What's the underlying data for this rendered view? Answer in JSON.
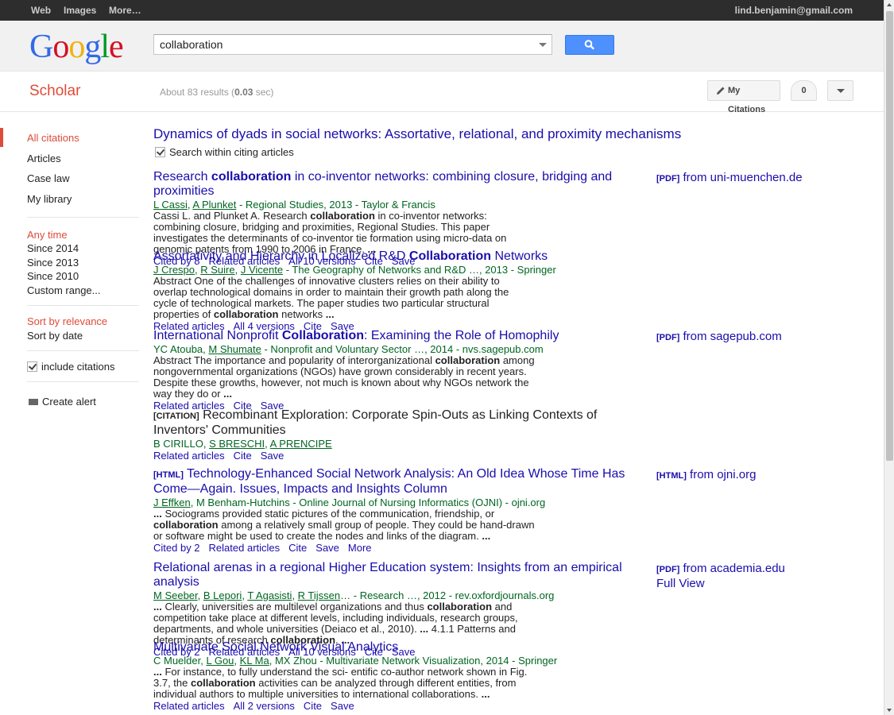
{
  "topbar": {
    "links": [
      "Web",
      "Images",
      "More…"
    ],
    "user": "lind.benjamin@gmail.com"
  },
  "logo": {
    "letters": [
      "G",
      "o",
      "o",
      "g",
      "l",
      "e"
    ],
    "colors": [
      "#3369e8",
      "#d50f25",
      "#eeb211",
      "#3369e8",
      "#009925",
      "#d50f25"
    ]
  },
  "search": {
    "value": "collaboration",
    "button_icon": "search-icon"
  },
  "scholar": {
    "title": "Scholar",
    "stats_prefix": "About 83 results (",
    "stats_time": "0.03",
    "stats_suffix": " sec)",
    "my_citations": "My Citations",
    "notifications": "0"
  },
  "sidebar": {
    "type": [
      "All citations",
      "Articles",
      "Case law",
      "My library"
    ],
    "time": [
      "Any time",
      "Since 2014",
      "Since 2013",
      "Since 2010",
      "Custom range..."
    ],
    "sort": [
      "Sort by relevance",
      "Sort by date"
    ],
    "include_citations": "include citations",
    "create_alert": "Create alert"
  },
  "main": {
    "cited_title": "Dynamics of dyads in social networks: Assortative, relational, and proximity mechanisms",
    "search_within": "Search within citing articles"
  },
  "results": [
    {
      "title_html": "Research <b>collaboration</b> in co-inventor networks: combining closure, bridging and proximities",
      "authors_html": "<span class=\"u\">L Cassi</span>, <span class=\"u\">A Plunket</span> - Regional Studies, 2013 - Taylor &amp; Francis",
      "snippet_html": "Cassi L. and Plunket A. Research <b>collaboration</b> in co-inventor networks: combining closure, bridging and proximities, Regional Studies. This paper investigates the determinants of co-inventor tie formation using micro-data on genomic patents from 1990 to 2006 in France. <b>...</b>",
      "links": [
        "Cited by 8",
        "Related articles",
        "All 10 versions",
        "Cite",
        "Save"
      ],
      "side_tag": "[PDF]",
      "side_text": "from uni-muenchen.de"
    },
    {
      "title_html": "Assortativity and Hierarchy in Localized R&amp;D <b>Collaboration</b> Networks",
      "authors_html": "<span class=\"u\">J Crespo</span>, <span class=\"u\">R Suire</span>, <span class=\"u\">J Vicente</span> - The Geography of Networks and R&amp;D …, 2013 - Springer",
      "snippet_html": "Abstract One of the challenges of innovative clusters relies on their ability to overlap technological domains in order to maintain their growth path along the cycle of technological markets. The paper studies two particular structural properties of <b>collaboration</b> networks <b>...</b>",
      "links": [
        "Related articles",
        "All 4 versions",
        "Cite",
        "Save"
      ]
    },
    {
      "title_html": "International Nonprofit <b>Collaboration</b>: Examining the Role of Homophily",
      "authors_html": "YC Atouba, <span class=\"u\">M Shumate</span> - Nonprofit and Voluntary Sector …, 2014 - nvs.sagepub.com",
      "snippet_html": "Abstract The importance and popularity of interorganizational <b>collaboration</b> among nongovernmental organizations (NGOs) have grown considerably in recent years. Despite these growths, however, not much is known about why NGOs network the way they do or <b>...</b>",
      "links": [
        "Related articles",
        "Cite",
        "Save"
      ],
      "side_tag": "[PDF]",
      "side_text": "from sagepub.com"
    },
    {
      "tag": "[CITATION]",
      "title_html": "Recombinant Exploration: Corporate Spin-Outs as Linking Contexts of Inventors' Communities",
      "authors_html": "B CIRILLO, <span class=\"u\">S BRESCHI</span>, <span class=\"u\">A PRENCIPE</span>",
      "links": [
        "Related articles",
        "Cite",
        "Save"
      ]
    },
    {
      "tag": "[HTML]",
      "title_html": "Technology-Enhanced Social Network Analysis: An Old Idea Whose Time Has Come—Again. Issues, Impacts and Insights Column",
      "authors_html": "<span class=\"u\">J Effken</span>, M Benham-Hutchins - Online Journal of Nursing Informatics (OJNI) - ojni.org",
      "snippet_html": "<b>...</b> Sociograms provided static pictures of the communication, friendship, or <b>collaboration</b> among a relatively small group of people. They could be hand-drawn or software might be used to create the nodes and links of the diagram. <b>...</b>",
      "links": [
        "Cited by 2",
        "Related articles",
        "Cite",
        "Save",
        "More"
      ],
      "side_tag": "[HTML]",
      "side_text": "from ojni.org"
    },
    {
      "title_html": "Relational arenas in a regional Higher Education system: Insights from an empirical analysis",
      "authors_html": "<span class=\"u\">M Seeber</span>, <span class=\"u\">B Lepori</span>, <span class=\"u\">T Agasisti</span>, <span class=\"u\">R Tijssen</span>… - Research …, 2012 - rev.oxfordjournals.org",
      "snippet_html": "<b>...</b> Clearly, universities are multilevel organizations and thus <b>collaboration</b> and competition take place at different levels, including individuals, research groups, departments, and whole universities (Deiaco et al., 2010). <b>...</b> 4.1.1 Patterns and determinants of research <b>collaboration</b>. <b>...</b>",
      "links": [
        "Cited by 2",
        "Related articles",
        "All 10 versions",
        "Cite",
        "Save"
      ],
      "side_tag": "[PDF]",
      "side_text": "from academia.edu",
      "side_extra": "Full View"
    },
    {
      "title_html": "Multivariate Social Network Visual Analytics",
      "authors_html": "C Muelder, <span class=\"u\">L Gou</span>, <span class=\"u\">KL Ma</span>, MX Zhou - Multivariate Network Visualization, 2014 - Springer",
      "snippet_html": "<b>...</b> For instance, to fully understand the sci- entific co-author network shown in Fig. 3.7, the <b>collaboration</b> activities can be analyzed through different entities, from individual authors to multiple universities to international collaborations. <b>...</b>",
      "links": [
        "Related articles",
        "All 2 versions",
        "Cite",
        "Save"
      ]
    }
  ]
}
